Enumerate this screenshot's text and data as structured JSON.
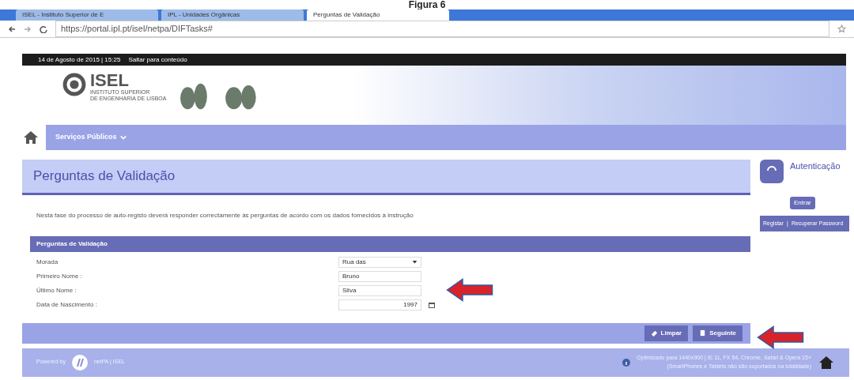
{
  "caption": "Figura 6",
  "browser": {
    "tabs": [
      {
        "label": "ISEL - Instituto Superior de E",
        "selected": false
      },
      {
        "label": "IPL - Unidades Orgânicas",
        "selected": false
      },
      {
        "label": "Perguntas de Validação",
        "selected": true
      }
    ],
    "url": "https://portal.ipl.pt/isel/netpa/DIFTasks#"
  },
  "topbar": {
    "date": "14 de Agosto de 2015 | 15:25",
    "skip_link": "Saltar para conteúdo"
  },
  "logo": {
    "name": "ISEL",
    "subtitle": [
      "INSTITUTO SUPERIOR",
      "DE ENGENHARIA DE LISBOA"
    ]
  },
  "nav": [
    {
      "label": "Serviços Públicos"
    }
  ],
  "page_title": "Perguntas de Validação",
  "intro": "Nesta fase do processo de auto-registo deverá responder correctamente às perguntas de acordo com os dados fornecidos à instrução",
  "form": {
    "title": "Perguntas de Validação",
    "fields": [
      {
        "label": "Morada",
        "kind": "select",
        "value": "Rua das"
      },
      {
        "label": "Primeiro Nome :",
        "kind": "text",
        "value": "Bruno"
      },
      {
        "label": "Último Nome :",
        "kind": "text",
        "value": "Silva"
      },
      {
        "label": "Data de Nascimento :",
        "kind": "date",
        "value": "1997"
      }
    ]
  },
  "buttons": [
    {
      "label": "Limpar",
      "kind": "clear"
    },
    {
      "label": "Seguinte",
      "kind": "next"
    }
  ],
  "sidebar": {
    "title": "Autenticação",
    "button": "Entrar",
    "links": [
      "Registar",
      "Recuperar Password"
    ],
    "separator": "|"
  },
  "footer": {
    "powered_by": "Powered by",
    "product": "netPA | ISEL",
    "notes": [
      "Optimizado para 1440x900 | IE 11, FX 54, Chrome, Safari & Opera 15+",
      "(SmartPhones e Tablets não são suportados na totalidade)"
    ]
  }
}
